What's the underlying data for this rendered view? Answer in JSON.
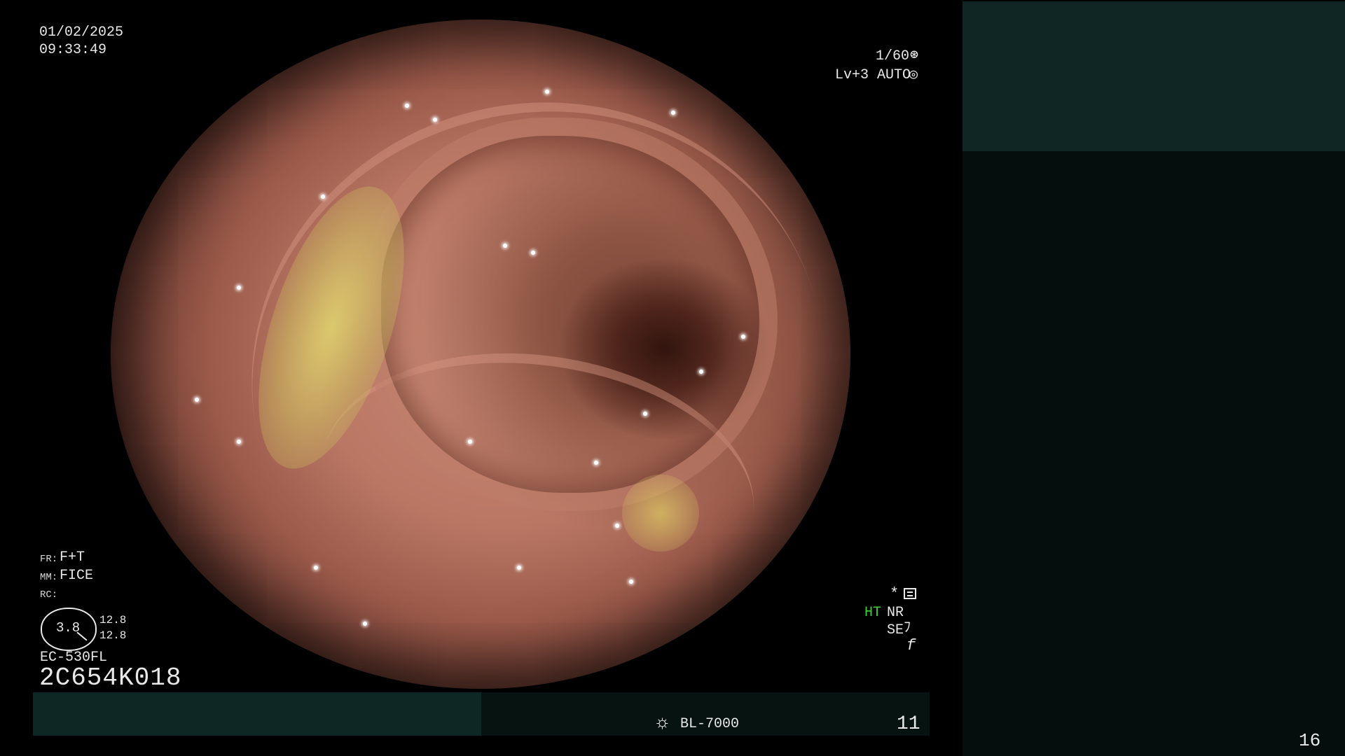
{
  "timestamp": {
    "date": "01/02/2025",
    "time": "09:33:49"
  },
  "exposure": {
    "shutter": "1/60",
    "shutter_icon": "⊛",
    "level_mode": "Lv+3 AUTO",
    "level_icon": "◎"
  },
  "settings": {
    "fr_label": "FR:",
    "fr_value": "F+T",
    "mm_label": "MM:",
    "mm_value": "FICE",
    "rc_label": "RC:",
    "rc_gauge_value": "3.8",
    "rc_value_1": "12.8",
    "rc_value_2": "12.8"
  },
  "scope": {
    "model": "EC-530FL",
    "serial": "2C654K018"
  },
  "right_indicators": {
    "star": "*",
    "ht": "HT",
    "nr": "NR",
    "se": "SE",
    "se_icon": "ﾌ",
    "f_icon": "f"
  },
  "status_bar": {
    "lamp_icon": "☼",
    "light_source": "BL-7000",
    "frame_count": "11"
  },
  "side_panel": {
    "number": "16"
  },
  "colors": {
    "ht_indicator": "#3fd13a",
    "strip_left": "#0e2624",
    "strip_right": "#061311",
    "side_top": "#0f2624",
    "side_bottom": "#050e0d"
  }
}
